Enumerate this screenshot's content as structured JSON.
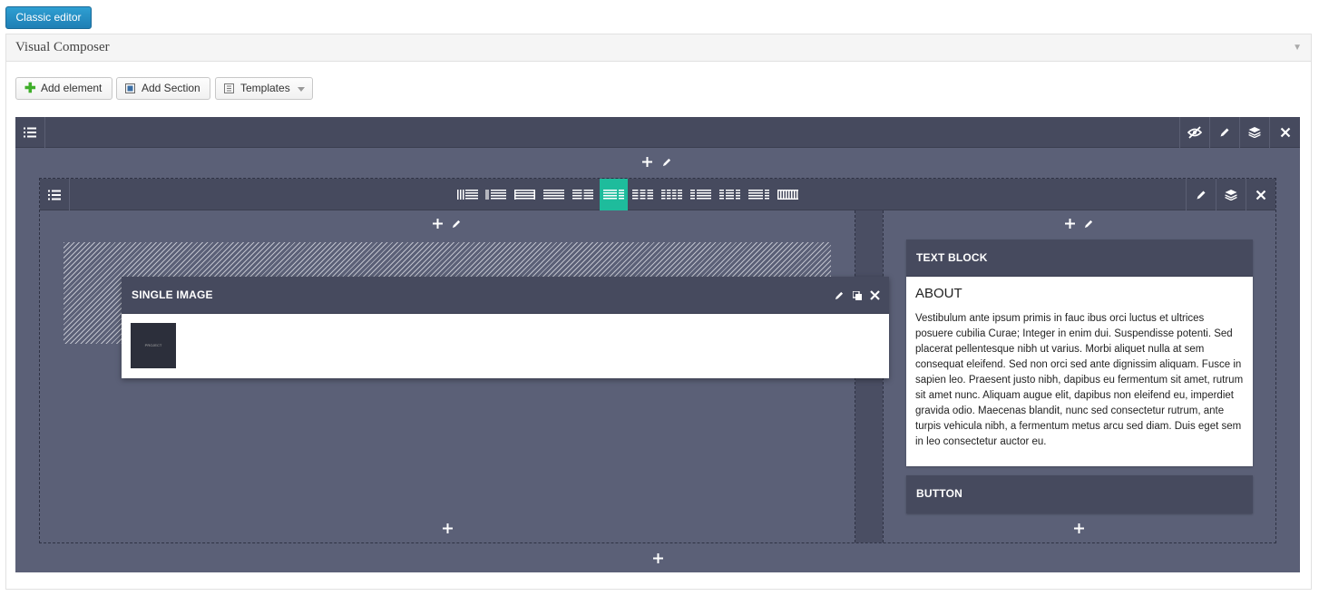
{
  "top": {
    "classic_editor_label": "Classic editor"
  },
  "panel": {
    "title": "Visual Composer",
    "toolbar": {
      "add_element": "Add element",
      "add_section": "Add Section",
      "templates": "Templates"
    }
  },
  "inner_row": {
    "active_layout_index": 5
  },
  "elements": {
    "single_image": {
      "title": "SINGLE IMAGE",
      "thumb_caption": "PROJECT"
    },
    "text_block": {
      "title": "TEXT BLOCK",
      "heading": "ABOUT",
      "body": "Vestibulum ante ipsum primis in fauc ibus orci luctus et ultrices posuere cubilia Curae; Integer in enim dui. Suspendisse potenti. Sed placerat pellentesque nibh ut varius. Morbi aliquet nulla at sem consequat eleifend. Sed non orci sed ante dignissim aliquam. Fusce in sapien leo. Praesent justo nibh, dapibus eu fermentum sit amet, rutrum sit amet nunc. Aliquam augue elit, dapibus non eleifend eu, imperdiet gravida odio. Maecenas blandit, nunc sed consectetur rutrum, ante turpis vehicula nibh, a fermentum metus arcu sed diam. Duis eget sem in leo consectetur auctor eu."
    },
    "button": {
      "title": "BUTTON"
    }
  },
  "colors": {
    "row_bg": "#5b6077",
    "bar_bg": "#464a5e",
    "accent_active": "#1ebc9c",
    "classic_button": "#2490c6"
  }
}
